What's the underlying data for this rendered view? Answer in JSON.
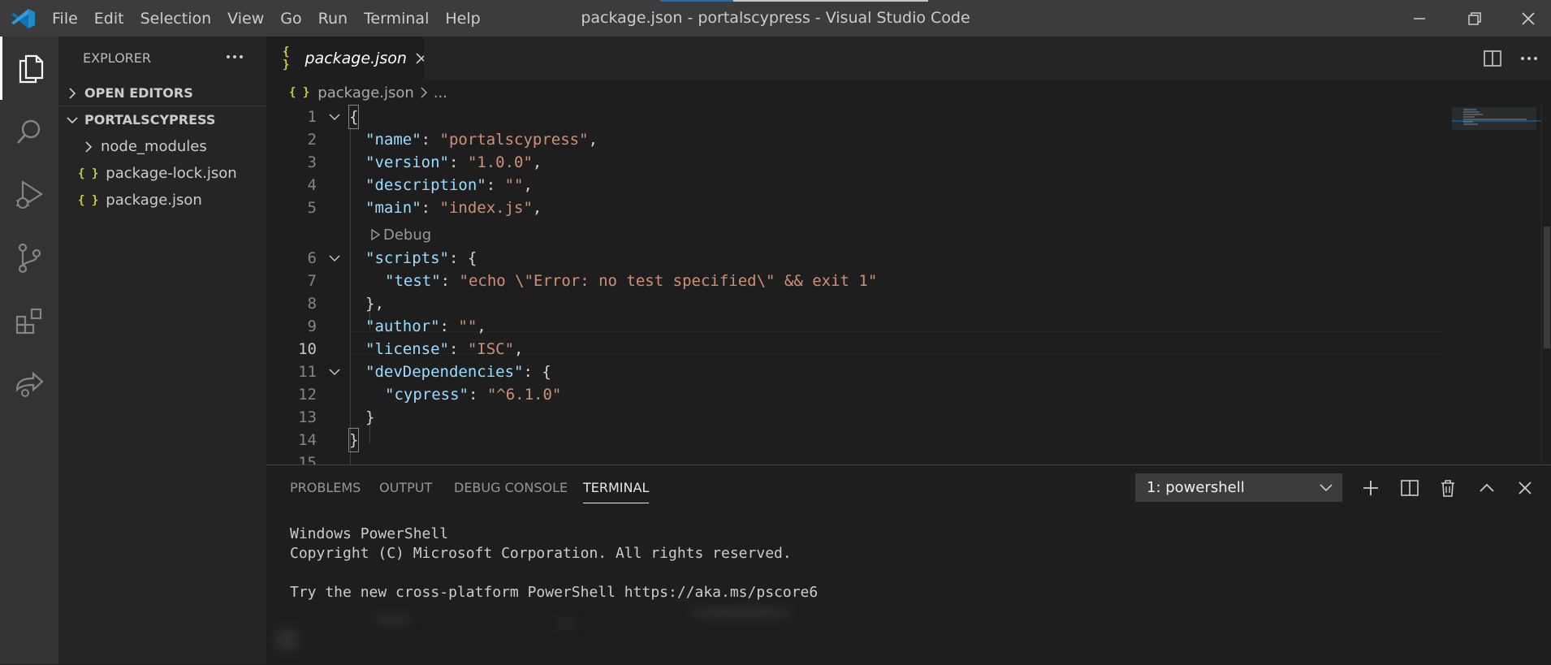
{
  "titlebar": {
    "menu": [
      "File",
      "Edit",
      "Selection",
      "View",
      "Go",
      "Run",
      "Terminal",
      "Help"
    ],
    "window_title": "package.json - portalscypress - Visual Studio Code"
  },
  "activity_bar": {
    "items": [
      "explorer-icon",
      "search-icon",
      "run-debug-icon",
      "source-control-icon",
      "extensions-icon",
      "live-share-icon"
    ]
  },
  "sidebar": {
    "title": "EXPLORER",
    "sections": [
      {
        "label": "OPEN EDITORS"
      },
      {
        "label": "PORTALSCYPRESS"
      }
    ],
    "tree": [
      {
        "label": "node_modules",
        "kind": "folder"
      },
      {
        "label": "package-lock.json",
        "kind": "json"
      },
      {
        "label": "package.json",
        "kind": "json"
      }
    ],
    "json_icon": "{ }"
  },
  "editor": {
    "tab": {
      "label": "package.json",
      "icon": "{ }"
    },
    "breadcrumb": {
      "file": "package.json",
      "rest": "..."
    },
    "codelens": "Debug",
    "lines": [
      {
        "n": "1",
        "text": "{"
      },
      {
        "n": "2",
        "key": "\"name\"",
        "val": "\"portalscypress\"",
        "tail": ","
      },
      {
        "n": "3",
        "key": "\"version\"",
        "val": "\"1.0.0\"",
        "tail": ","
      },
      {
        "n": "4",
        "key": "\"description\"",
        "val": "\"\"",
        "tail": ","
      },
      {
        "n": "5",
        "key": "\"main\"",
        "val": "\"index.js\"",
        "tail": ","
      },
      {
        "n": "6",
        "key": "\"scripts\"",
        "tail": ": {"
      },
      {
        "n": "7",
        "key": "\"test\"",
        "val": "\"echo \\\"Error: no test specified\\\" && exit 1\""
      },
      {
        "n": "8",
        "text": "},"
      },
      {
        "n": "9",
        "key": "\"author\"",
        "val": "\"\"",
        "tail": ","
      },
      {
        "n": "10",
        "key": "\"license\"",
        "val": "\"ISC\"",
        "tail": ","
      },
      {
        "n": "11",
        "key": "\"devDependencies\"",
        "tail": ": {"
      },
      {
        "n": "12",
        "key": "\"cypress\"",
        "val": "\"^6.1.0\""
      },
      {
        "n": "13",
        "text": "}"
      },
      {
        "n": "14",
        "text": "}"
      },
      {
        "n": "15",
        "text": ""
      }
    ]
  },
  "panel": {
    "tabs": [
      "PROBLEMS",
      "OUTPUT",
      "DEBUG CONSOLE",
      "TERMINAL"
    ],
    "active_tab": "TERMINAL",
    "terminal_select": "1: powershell",
    "terminal_lines": [
      "Windows PowerShell",
      "Copyright (C) Microsoft Corporation. All rights reserved.",
      "",
      "Try the new cross-platform PowerShell https://aka.ms/pscore6"
    ]
  },
  "colors": {
    "accent": "#007acc",
    "json_icon": "#cbcb41",
    "key": "#9cdcfe",
    "string": "#ce9178"
  }
}
